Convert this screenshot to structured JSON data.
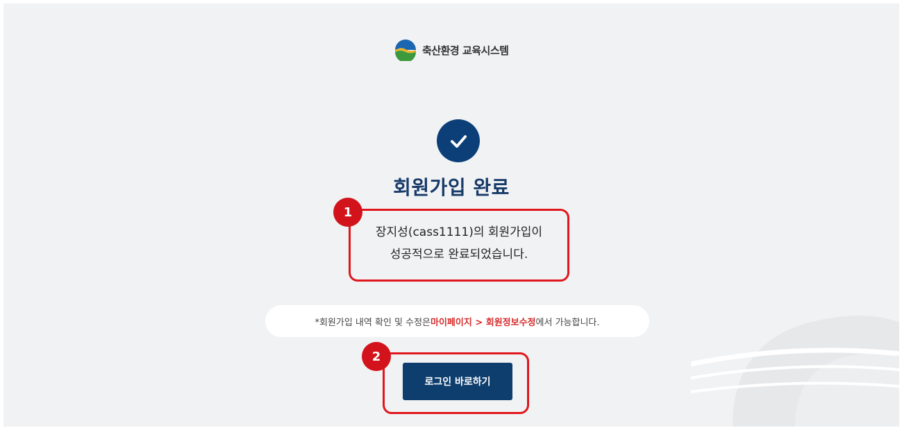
{
  "logo": {
    "text": "축산환경 교육시스템",
    "icon": "logo-emblem-icon"
  },
  "status": {
    "icon": "check-circle-icon",
    "title": "회원가입 완료"
  },
  "message": {
    "line1": "장지성(cass1111)의 회원가입이",
    "line2": "성공적으로 완료되었습니다."
  },
  "notice": {
    "prefix": "*회원가입 내역 확인 및 수정은 ",
    "path": "마이페이지 > 회원정보수정",
    "suffix": "에서 가능합니다."
  },
  "actions": {
    "login_label": "로그인 바로하기"
  },
  "annotations": {
    "step1": "1",
    "step2": "2"
  },
  "colors": {
    "primary": "#0c3f78",
    "highlight": "#e0161c",
    "notice_accent": "#d62b2b",
    "background": "#f1f2f4"
  }
}
